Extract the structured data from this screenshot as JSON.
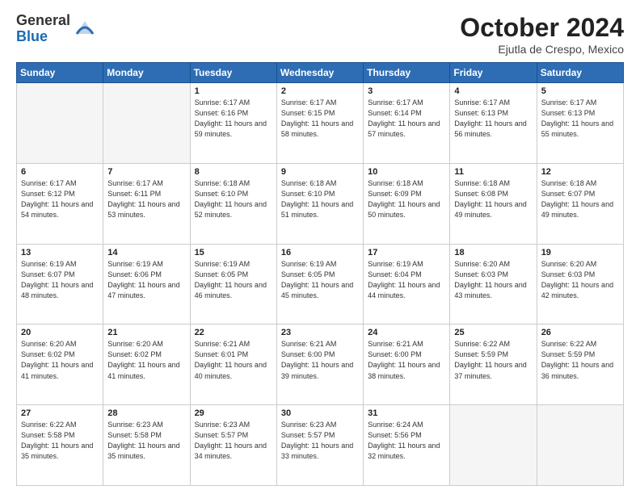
{
  "logo": {
    "general": "General",
    "blue": "Blue"
  },
  "header": {
    "month": "October 2024",
    "location": "Ejutla de Crespo, Mexico"
  },
  "weekdays": [
    "Sunday",
    "Monday",
    "Tuesday",
    "Wednesday",
    "Thursday",
    "Friday",
    "Saturday"
  ],
  "weeks": [
    [
      {
        "day": "",
        "empty": true
      },
      {
        "day": "",
        "empty": true
      },
      {
        "day": "1",
        "sunrise": "6:17 AM",
        "sunset": "6:16 PM",
        "daylight": "11 hours and 59 minutes."
      },
      {
        "day": "2",
        "sunrise": "6:17 AM",
        "sunset": "6:15 PM",
        "daylight": "11 hours and 58 minutes."
      },
      {
        "day": "3",
        "sunrise": "6:17 AM",
        "sunset": "6:14 PM",
        "daylight": "11 hours and 57 minutes."
      },
      {
        "day": "4",
        "sunrise": "6:17 AM",
        "sunset": "6:13 PM",
        "daylight": "11 hours and 56 minutes."
      },
      {
        "day": "5",
        "sunrise": "6:17 AM",
        "sunset": "6:13 PM",
        "daylight": "11 hours and 55 minutes."
      }
    ],
    [
      {
        "day": "6",
        "sunrise": "6:17 AM",
        "sunset": "6:12 PM",
        "daylight": "11 hours and 54 minutes."
      },
      {
        "day": "7",
        "sunrise": "6:17 AM",
        "sunset": "6:11 PM",
        "daylight": "11 hours and 53 minutes."
      },
      {
        "day": "8",
        "sunrise": "6:18 AM",
        "sunset": "6:10 PM",
        "daylight": "11 hours and 52 minutes."
      },
      {
        "day": "9",
        "sunrise": "6:18 AM",
        "sunset": "6:10 PM",
        "daylight": "11 hours and 51 minutes."
      },
      {
        "day": "10",
        "sunrise": "6:18 AM",
        "sunset": "6:09 PM",
        "daylight": "11 hours and 50 minutes."
      },
      {
        "day": "11",
        "sunrise": "6:18 AM",
        "sunset": "6:08 PM",
        "daylight": "11 hours and 49 minutes."
      },
      {
        "day": "12",
        "sunrise": "6:18 AM",
        "sunset": "6:07 PM",
        "daylight": "11 hours and 49 minutes."
      }
    ],
    [
      {
        "day": "13",
        "sunrise": "6:19 AM",
        "sunset": "6:07 PM",
        "daylight": "11 hours and 48 minutes."
      },
      {
        "day": "14",
        "sunrise": "6:19 AM",
        "sunset": "6:06 PM",
        "daylight": "11 hours and 47 minutes."
      },
      {
        "day": "15",
        "sunrise": "6:19 AM",
        "sunset": "6:05 PM",
        "daylight": "11 hours and 46 minutes."
      },
      {
        "day": "16",
        "sunrise": "6:19 AM",
        "sunset": "6:05 PM",
        "daylight": "11 hours and 45 minutes."
      },
      {
        "day": "17",
        "sunrise": "6:19 AM",
        "sunset": "6:04 PM",
        "daylight": "11 hours and 44 minutes."
      },
      {
        "day": "18",
        "sunrise": "6:20 AM",
        "sunset": "6:03 PM",
        "daylight": "11 hours and 43 minutes."
      },
      {
        "day": "19",
        "sunrise": "6:20 AM",
        "sunset": "6:03 PM",
        "daylight": "11 hours and 42 minutes."
      }
    ],
    [
      {
        "day": "20",
        "sunrise": "6:20 AM",
        "sunset": "6:02 PM",
        "daylight": "11 hours and 41 minutes."
      },
      {
        "day": "21",
        "sunrise": "6:20 AM",
        "sunset": "6:02 PM",
        "daylight": "11 hours and 41 minutes."
      },
      {
        "day": "22",
        "sunrise": "6:21 AM",
        "sunset": "6:01 PM",
        "daylight": "11 hours and 40 minutes."
      },
      {
        "day": "23",
        "sunrise": "6:21 AM",
        "sunset": "6:00 PM",
        "daylight": "11 hours and 39 minutes."
      },
      {
        "day": "24",
        "sunrise": "6:21 AM",
        "sunset": "6:00 PM",
        "daylight": "11 hours and 38 minutes."
      },
      {
        "day": "25",
        "sunrise": "6:22 AM",
        "sunset": "5:59 PM",
        "daylight": "11 hours and 37 minutes."
      },
      {
        "day": "26",
        "sunrise": "6:22 AM",
        "sunset": "5:59 PM",
        "daylight": "11 hours and 36 minutes."
      }
    ],
    [
      {
        "day": "27",
        "sunrise": "6:22 AM",
        "sunset": "5:58 PM",
        "daylight": "11 hours and 35 minutes."
      },
      {
        "day": "28",
        "sunrise": "6:23 AM",
        "sunset": "5:58 PM",
        "daylight": "11 hours and 35 minutes."
      },
      {
        "day": "29",
        "sunrise": "6:23 AM",
        "sunset": "5:57 PM",
        "daylight": "11 hours and 34 minutes."
      },
      {
        "day": "30",
        "sunrise": "6:23 AM",
        "sunset": "5:57 PM",
        "daylight": "11 hours and 33 minutes."
      },
      {
        "day": "31",
        "sunrise": "6:24 AM",
        "sunset": "5:56 PM",
        "daylight": "11 hours and 32 minutes."
      },
      {
        "day": "",
        "empty": true
      },
      {
        "day": "",
        "empty": true
      }
    ]
  ]
}
